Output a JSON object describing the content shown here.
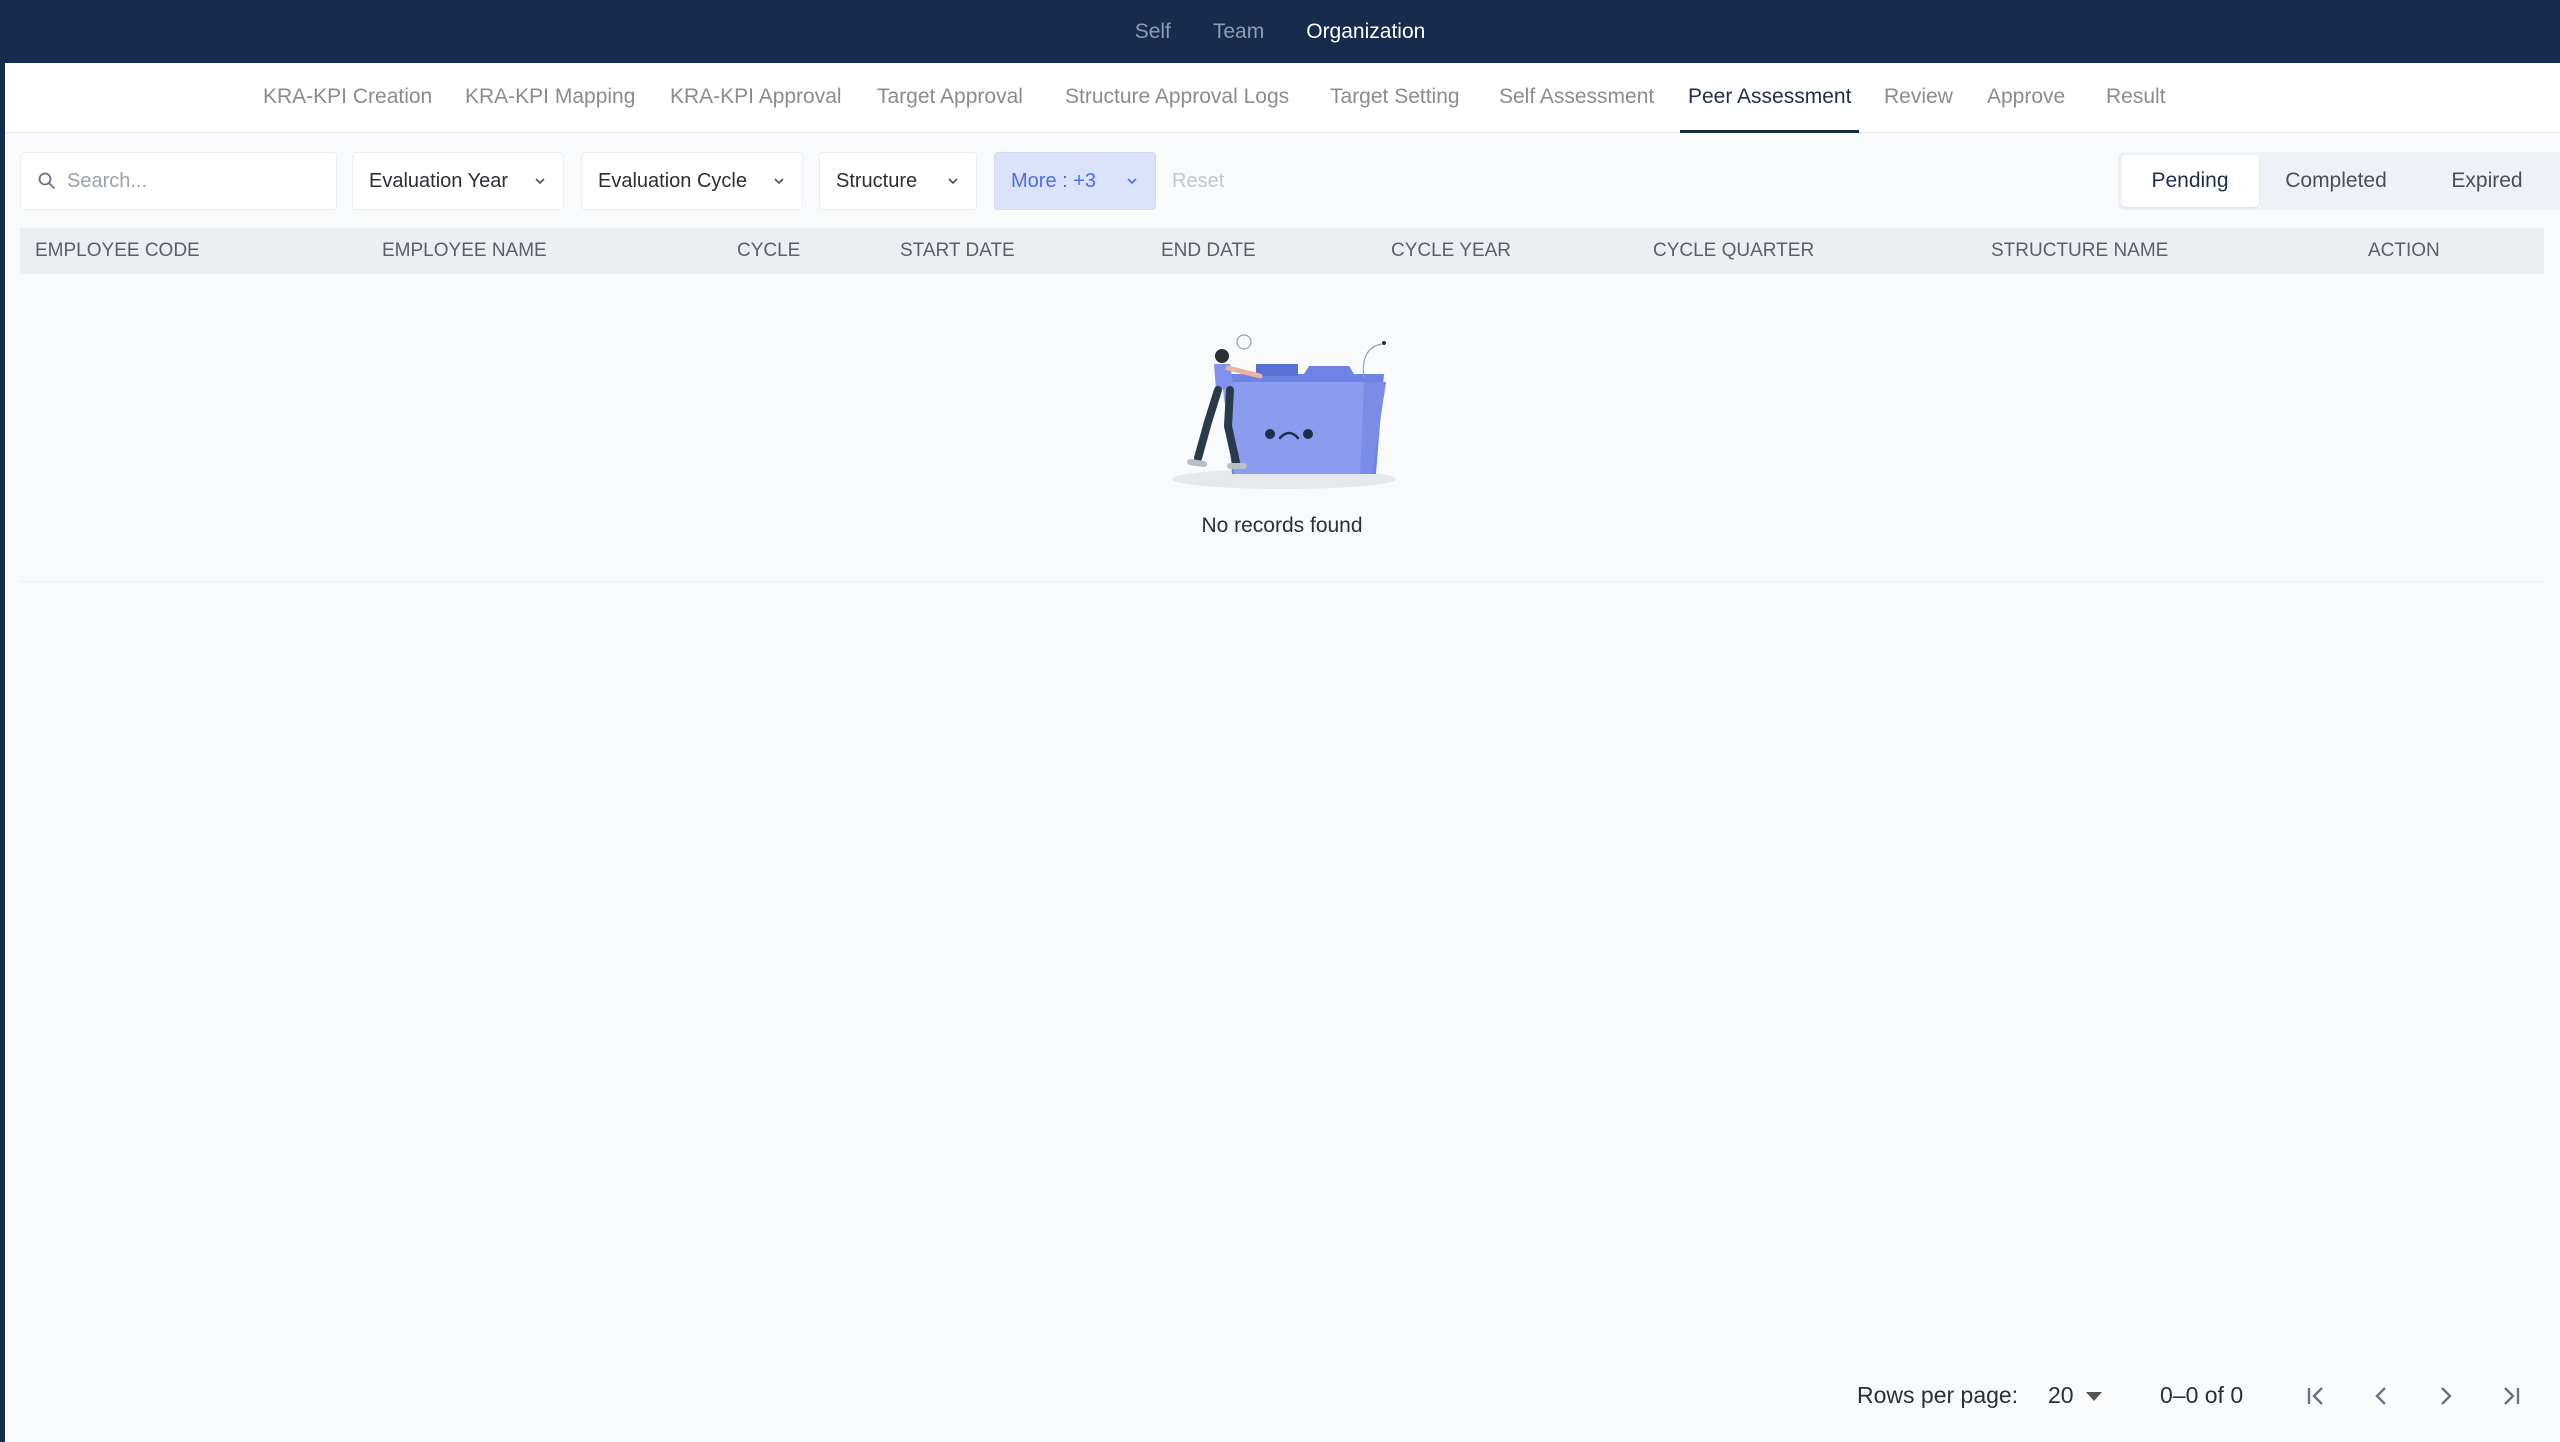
{
  "top_tabs": [
    "Self",
    "Team",
    "Organization"
  ],
  "sub_tabs": [
    "KRA-KPI Creation",
    "KRA-KPI Mapping",
    "KRA-KPI Approval",
    "Target Approval",
    "Structure Approval Logs",
    "Target Setting",
    "Self Assessment",
    "Peer Assessment",
    "Review",
    "Approve",
    "Result"
  ],
  "active_sub_tab": "Peer Assessment",
  "search": {
    "placeholder": "Search..."
  },
  "filters": {
    "evaluation_year": "Evaluation Year",
    "evaluation_cycle": "Evaluation Cycle",
    "structure": "Structure",
    "more": "More : +3",
    "reset": "Reset"
  },
  "status_tabs": [
    "Pending",
    "Completed",
    "Expired"
  ],
  "active_status": "Pending",
  "table": {
    "columns": [
      "EMPLOYEE CODE",
      "EMPLOYEE NAME",
      "CYCLE",
      "START DATE",
      "END DATE",
      "CYCLE YEAR",
      "CYCLE QUARTER",
      "STRUCTURE NAME",
      "ACTION"
    ],
    "rows": []
  },
  "empty_message": "No records found",
  "pagination": {
    "rows_per_page_label": "Rows per page:",
    "rows_per_page": "20",
    "range": "0–0 of 0"
  },
  "colors": {
    "topbar": "#172b4d",
    "accent": "#4a6cf0",
    "more_bg": "#dbe3fb",
    "illustration": "#8b9cf0"
  }
}
